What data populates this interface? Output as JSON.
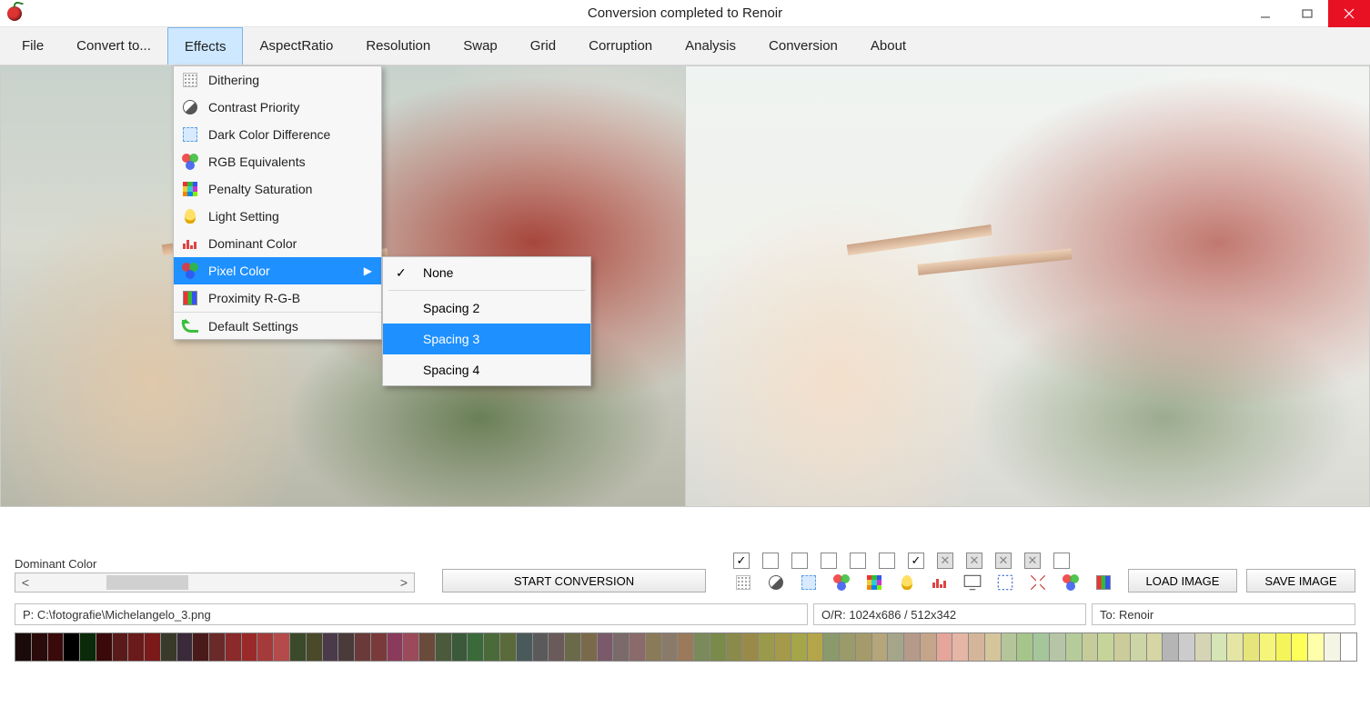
{
  "window": {
    "title": "Conversion completed to Renoir"
  },
  "menubar": {
    "items": [
      "File",
      "Convert to...",
      "Effects",
      "AspectRatio",
      "Resolution",
      "Swap",
      "Grid",
      "Corruption",
      "Analysis",
      "Conversion",
      "About"
    ],
    "active_index": 2
  },
  "effects_menu": {
    "items": [
      "Dithering",
      "Contrast Priority",
      "Dark Color Difference",
      "RGB Equivalents",
      "Penalty Saturation",
      "Light Setting",
      "Dominant Color",
      "Pixel Color",
      "Proximity R-G-B",
      "Default Settings"
    ],
    "selected_index": 7
  },
  "pixel_color_submenu": {
    "items": [
      "None",
      "Spacing 2",
      "Spacing 3",
      "Spacing 4"
    ],
    "checked_index": 0,
    "hover_index": 2
  },
  "lower": {
    "dominant_label": "Dominant Color",
    "start_button": "START CONVERSION",
    "load_button": "LOAD IMAGE",
    "save_button": "SAVE IMAGE"
  },
  "checkbox_row": [
    true,
    false,
    false,
    false,
    false,
    false,
    true,
    false,
    false,
    false,
    false,
    false
  ],
  "checkbox_disabled": [
    false,
    false,
    false,
    false,
    false,
    false,
    false,
    true,
    true,
    true,
    true,
    false
  ],
  "status": {
    "path": "P:  C:\\fotografie\\Michelangelo_3.png",
    "or": "O/R:  1024x686 / 512x342",
    "to": "To:  Renoir"
  },
  "palette": [
    "#1a0a0a",
    "#2a0a0a",
    "#3a0a0a",
    "#000000",
    "#0a2a0a",
    "#3a0a0a",
    "#5a1a1a",
    "#6a1a1a",
    "#7a1a1a",
    "#3a3a2a",
    "#3a2a3a",
    "#4a1a1a",
    "#6a2a2a",
    "#8a2a2a",
    "#9a2a2a",
    "#a53a3a",
    "#b54a4a",
    "#3a4a2a",
    "#4a4a2a",
    "#4a3a4a",
    "#4a3a3a",
    "#6a3a3a",
    "#7a3a3a",
    "#8a3a5a",
    "#9a4a5a",
    "#6a4a3a",
    "#4a5a3a",
    "#3a5a3a",
    "#3a6a3a",
    "#4a6a3a",
    "#5a6a3a",
    "#4a5a5a",
    "#5a5a5a",
    "#6a5a5a",
    "#6a6a4a",
    "#7a6a4a",
    "#7a5a6a",
    "#7a6a6a",
    "#8a6a6a",
    "#8a7a5a",
    "#8a7a6a",
    "#9a7a5a",
    "#7a8a5a",
    "#7a8a4a",
    "#8a8a4a",
    "#9a8a4a",
    "#9a9a4a",
    "#a59a4a",
    "#a5a54a",
    "#b5a54a",
    "#8a9a6a",
    "#9a9a6a",
    "#a59a6a",
    "#b5a57a",
    "#a5a58a",
    "#b59a8a",
    "#c5a58a",
    "#e5a59a",
    "#e5b5a5",
    "#d5b59a",
    "#d5c59a",
    "#b5c59a",
    "#a5c58a",
    "#a5c59a",
    "#b5c5a5",
    "#b5cc9a",
    "#c5cc9a",
    "#c5d59a",
    "#cccc9a",
    "#ccd5a5",
    "#d5d5a5",
    "#b5b5b5",
    "#cccccc",
    "#d5d5b5",
    "#d5e5b5",
    "#e5e5a5",
    "#e5e57a",
    "#f5f57a",
    "#f5f55a",
    "#ffff5a",
    "#ffffaa",
    "#f5f5e5",
    "#ffffff"
  ]
}
